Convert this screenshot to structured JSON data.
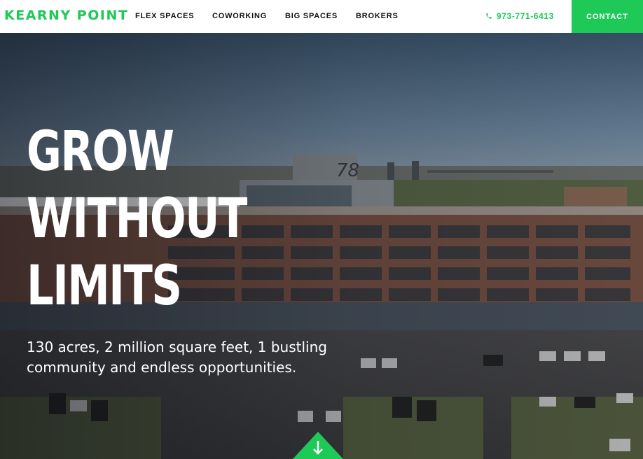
{
  "brand": {
    "logo_text": "KEARNY POINT",
    "accent_color": "#1fc958"
  },
  "nav": {
    "links": [
      "FLEX SPACES",
      "COWORKING",
      "BIG SPACES",
      "BROKERS"
    ],
    "phone": "973-771-6413",
    "phone_icon": "phone-icon",
    "contact_label": "CONTACT"
  },
  "hero": {
    "headline_lines": [
      "GROW",
      "WITHOUT",
      "LIMITS"
    ],
    "subtext": "130 acres, 2 million square feet, 1 bustling community and endless opportunities.",
    "building_sign": "78",
    "scroll_icon": "arrow-down-icon"
  }
}
